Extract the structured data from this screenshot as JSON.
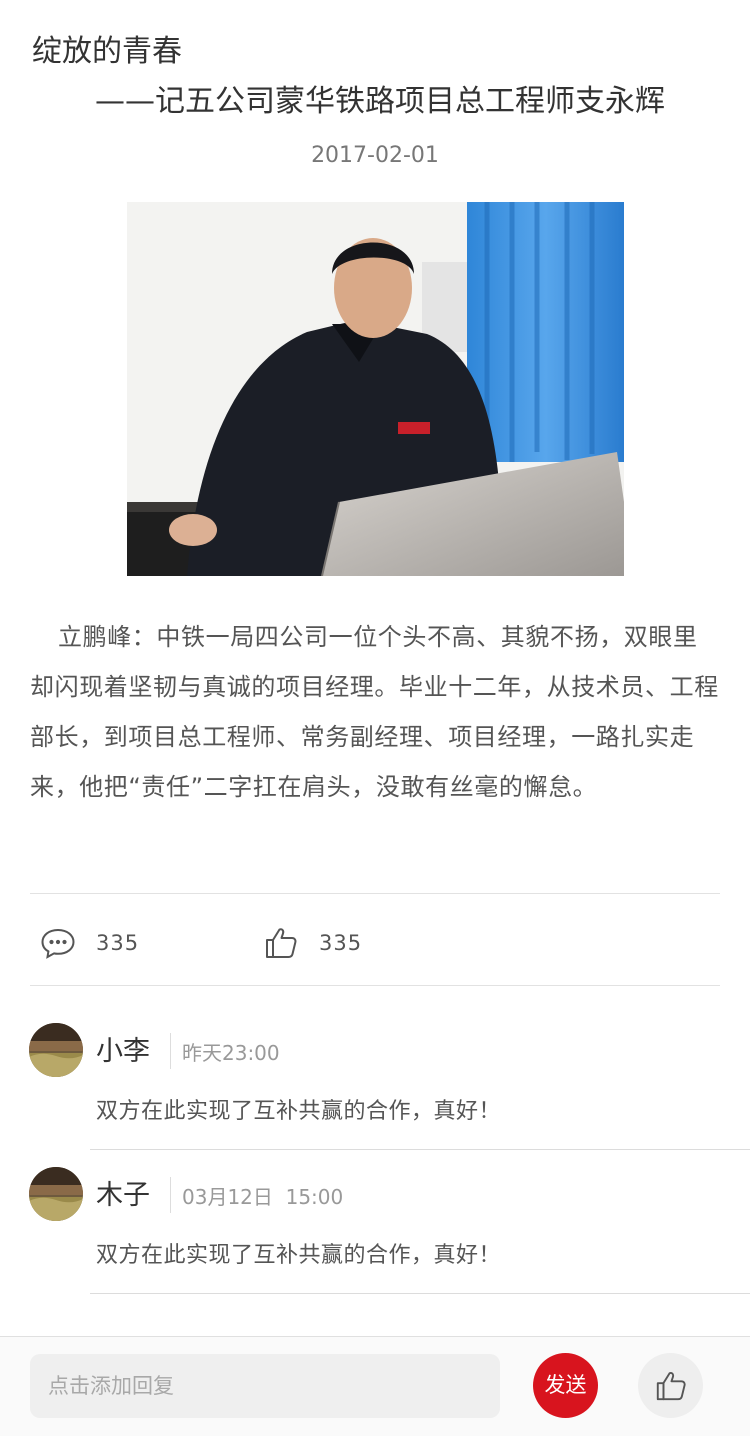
{
  "article": {
    "title": "绽放的青春",
    "subtitle": "——记五公司蒙华铁路项目总工程师支永辉",
    "date": "2017-02-01",
    "body": "立鹏峰：中铁一局四公司一位个头不高、其貌不扬，双眼里却闪现着坚韧与真诚的项目经理。毕业十二年，从技术员、工程部长，到项目总工程师、常务副经理、项目经理，一路扎实走来，他把“责任”二字扛在肩头，没敢有丝毫的懈怠。"
  },
  "stats": {
    "comment_count": "335",
    "like_count": "335"
  },
  "comments": [
    {
      "name": "小李",
      "time": "昨天23:00",
      "text": "双方在此实现了互补共赢的合作，真好！"
    },
    {
      "name": "木子",
      "time": "03月12日  15:00",
      "text": "双方在此实现了互补共赢的合作，真好！"
    }
  ],
  "reply_bar": {
    "placeholder": "点击添加回复",
    "send_label": "发送"
  },
  "colors": {
    "accent": "#d8141e",
    "input_bg": "#efefef"
  },
  "icons": {
    "comment": "comment-bubble-icon",
    "like": "thumbs-up-icon"
  }
}
